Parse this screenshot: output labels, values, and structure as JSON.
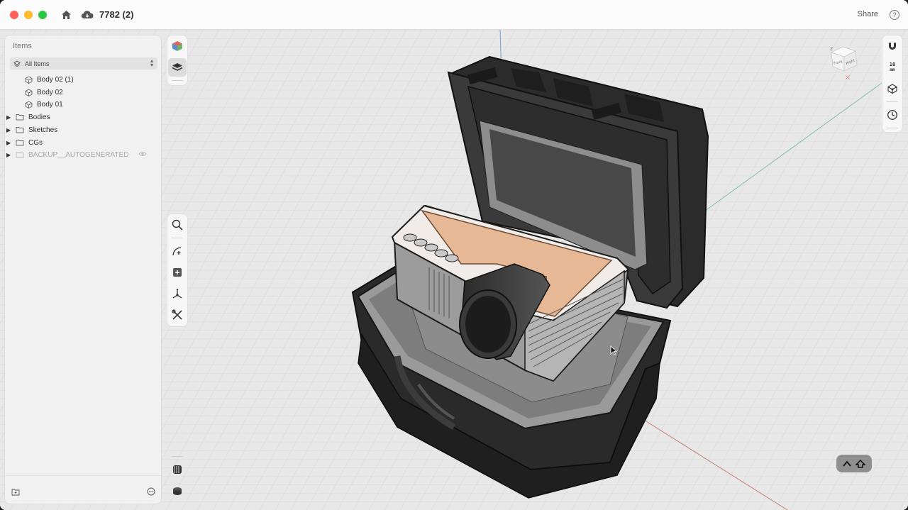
{
  "titlebar": {
    "document_title": "7782 (2)",
    "share_label": "Share",
    "help_label": "?"
  },
  "items_panel": {
    "title": "Items",
    "filter": {
      "selected": "All Items"
    },
    "tree": [
      {
        "label": "Body 02 (1)",
        "type": "body",
        "expandable": false,
        "hidden": false
      },
      {
        "label": "Body 02",
        "type": "body",
        "expandable": false,
        "hidden": false
      },
      {
        "label": "Body 01",
        "type": "body",
        "expandable": false,
        "hidden": false
      },
      {
        "label": "Bodies",
        "type": "folder",
        "expandable": true,
        "hidden": false
      },
      {
        "label": "Sketches",
        "type": "folder",
        "expandable": true,
        "hidden": false
      },
      {
        "label": "CGs",
        "type": "folder",
        "expandable": true,
        "hidden": false
      },
      {
        "label": "BACKUP__AUTOGENERATED",
        "type": "folder",
        "expandable": true,
        "hidden": true
      }
    ]
  },
  "right_toolbar": {
    "grid_size_value": "10",
    "grid_size_unit": "mm"
  },
  "viewcube": {
    "faces": [
      "Front",
      "Right"
    ],
    "axis_label": "Z"
  },
  "colors": {
    "accent_wood": "#e6b896",
    "case_dark": "#2b2b2b",
    "foam_gray": "#8e8e8e",
    "axis_x": "#c77a72",
    "axis_y": "#7fc0a8",
    "axis_z": "#7b9fd8"
  }
}
